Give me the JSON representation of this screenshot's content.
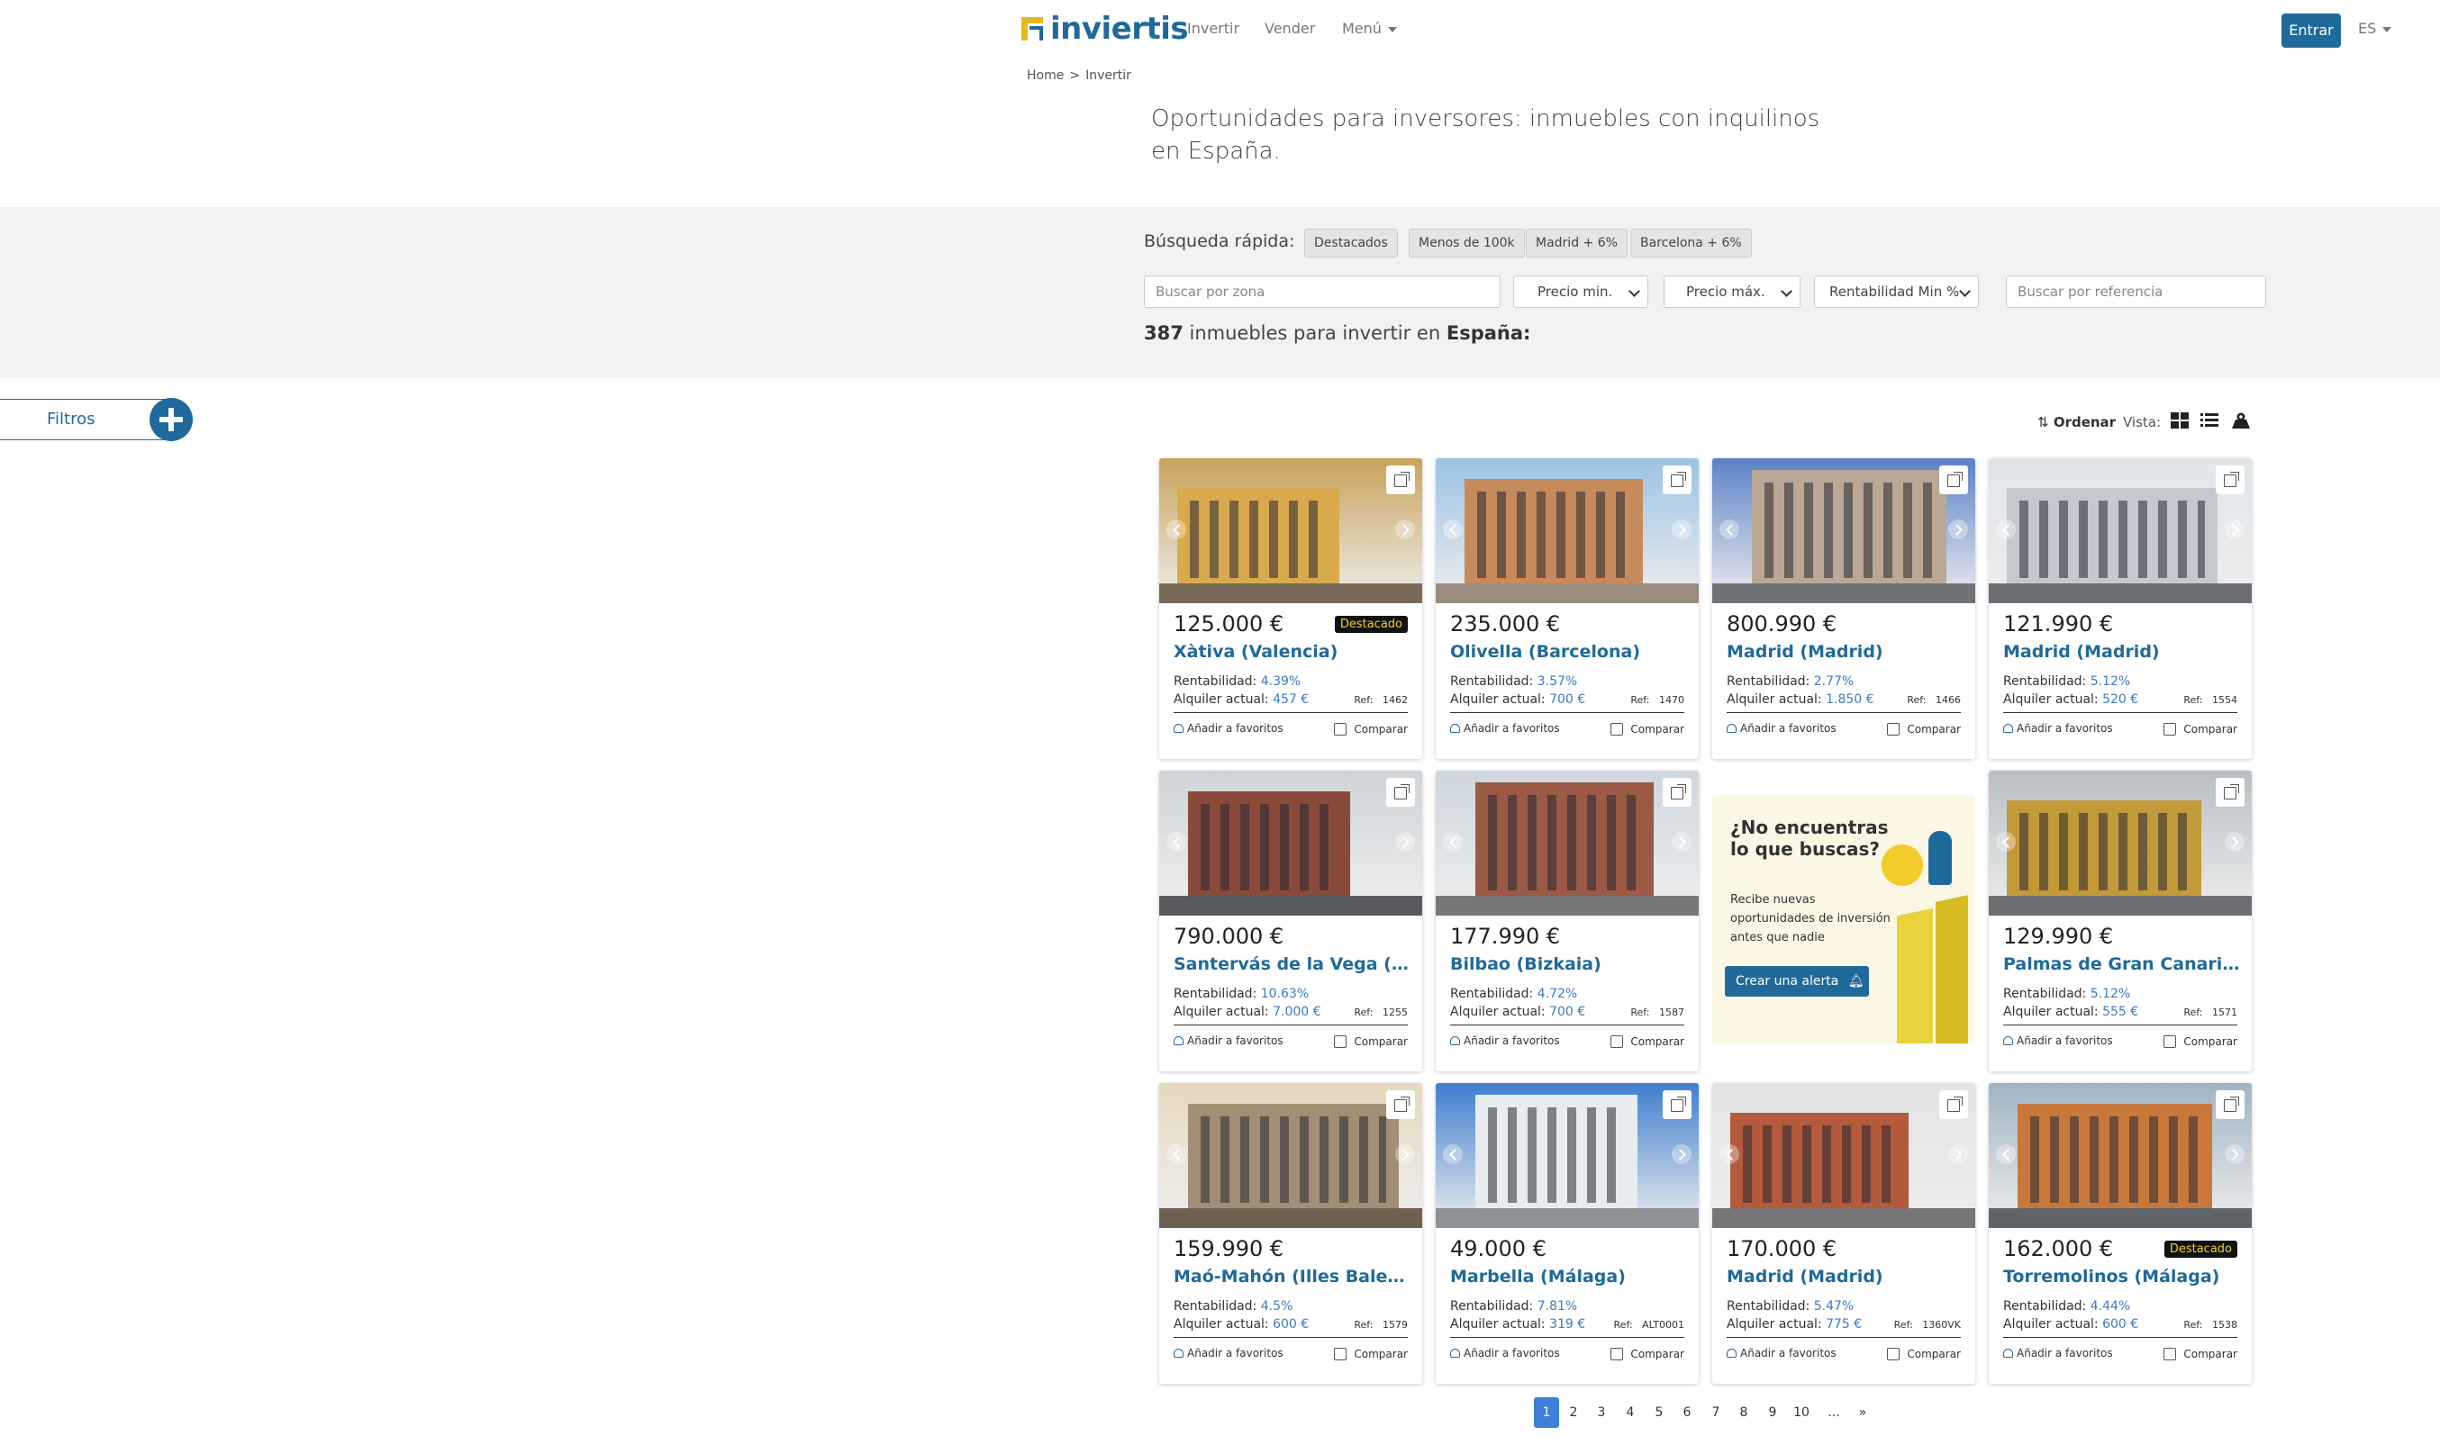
{
  "header": {
    "brand": "inviertis",
    "nav": [
      "Invertir",
      "Vender",
      "Menú"
    ],
    "login_label": "Entrar",
    "lang": "ES"
  },
  "breadcrumb": [
    "Home",
    ">",
    "Invertir"
  ],
  "heading": "Oportunidades para inversores: inmuebles con inquilinos en España.",
  "search": {
    "quick_label": "Búsqueda rápida:",
    "chips": [
      "Destacados",
      "Menos de 100k",
      "Madrid + 6%",
      "Barcelona + 6%"
    ],
    "zone_placeholder": "Buscar por zona",
    "price_min": "Precio min.",
    "price_max": "Precio máx.",
    "rent_min": "Rentabilidad Min %",
    "ref_placeholder": "Buscar por referencia"
  },
  "results": {
    "count": "387",
    "text": " inmuebles para invertir en ",
    "place": "España:"
  },
  "filters_label": "Filtros",
  "toolbar": {
    "order_label": "Ordenar",
    "view_label": "Vista:",
    "icons": [
      "grid-view-icon",
      "list-view-icon",
      "map-view-icon"
    ]
  },
  "labels": {
    "rent": "Rentabilidad: ",
    "alq": "Alquiler actual: ",
    "ref": "Ref:",
    "fav": "Añadir a favoritos",
    "compare": "Comparar"
  },
  "listings": [
    {
      "price": "125.000 €",
      "badge": "Destacado",
      "location": "Xàtiva (Valencia)",
      "rent": "4.39%",
      "alq": "457 €",
      "ref": "1462"
    },
    {
      "price": "235.000 €",
      "badge": "",
      "location": "Olivella (Barcelona)",
      "rent": "3.57%",
      "alq": "700 €",
      "ref": "1470"
    },
    {
      "price": "800.990 €",
      "badge": "",
      "location": "Madrid (Madrid)",
      "rent": "2.77%",
      "alq": "1.850 €",
      "ref": "1466"
    },
    {
      "price": "121.990 €",
      "badge": "",
      "location": "Madrid (Madrid)",
      "rent": "5.12%",
      "alq": "520 €",
      "ref": "1554"
    },
    {
      "price": "790.000 €",
      "badge": "",
      "location": "Santervás de la Vega (Pal…",
      "rent": "10.63%",
      "alq": "7.000 €",
      "ref": "1255"
    },
    {
      "price": "177.990 €",
      "badge": "",
      "location": "Bilbao (Bizkaia)",
      "rent": "4.72%",
      "alq": "700 €",
      "ref": "1587"
    },
    {
      "price": "129.990 €",
      "badge": "",
      "location": "Palmas de Gran Canaria, L…",
      "rent": "5.12%",
      "alq": "555 €",
      "ref": "1571"
    },
    {
      "price": "159.990 €",
      "badge": "",
      "location": "Maó-Mahón (Illes Balears)",
      "rent": "4.5%",
      "alq": "600 €",
      "ref": "1579"
    },
    {
      "price": "49.000 €",
      "badge": "",
      "location": "Marbella (Málaga)",
      "rent": "7.81%",
      "alq": "319 €",
      "ref": "ALT0001"
    },
    {
      "price": "170.000 €",
      "badge": "",
      "location": "Madrid (Madrid)",
      "rent": "5.47%",
      "alq": "775 €",
      "ref": "1360VK"
    },
    {
      "price": "162.000 €",
      "badge": "Destacado",
      "location": "Torremolinos (Málaga)",
      "rent": "4.44%",
      "alq": "600 €",
      "ref": "1538"
    }
  ],
  "promo": {
    "question": "¿No encuentras lo que buscas?",
    "text": "Recibe nuevas oportunidades de inversión antes que nadie",
    "cta": "Crear una alerta"
  },
  "pagination": [
    "1",
    "2",
    "3",
    "4",
    "5",
    "6",
    "7",
    "8",
    "9",
    "10",
    "...",
    "»"
  ]
}
